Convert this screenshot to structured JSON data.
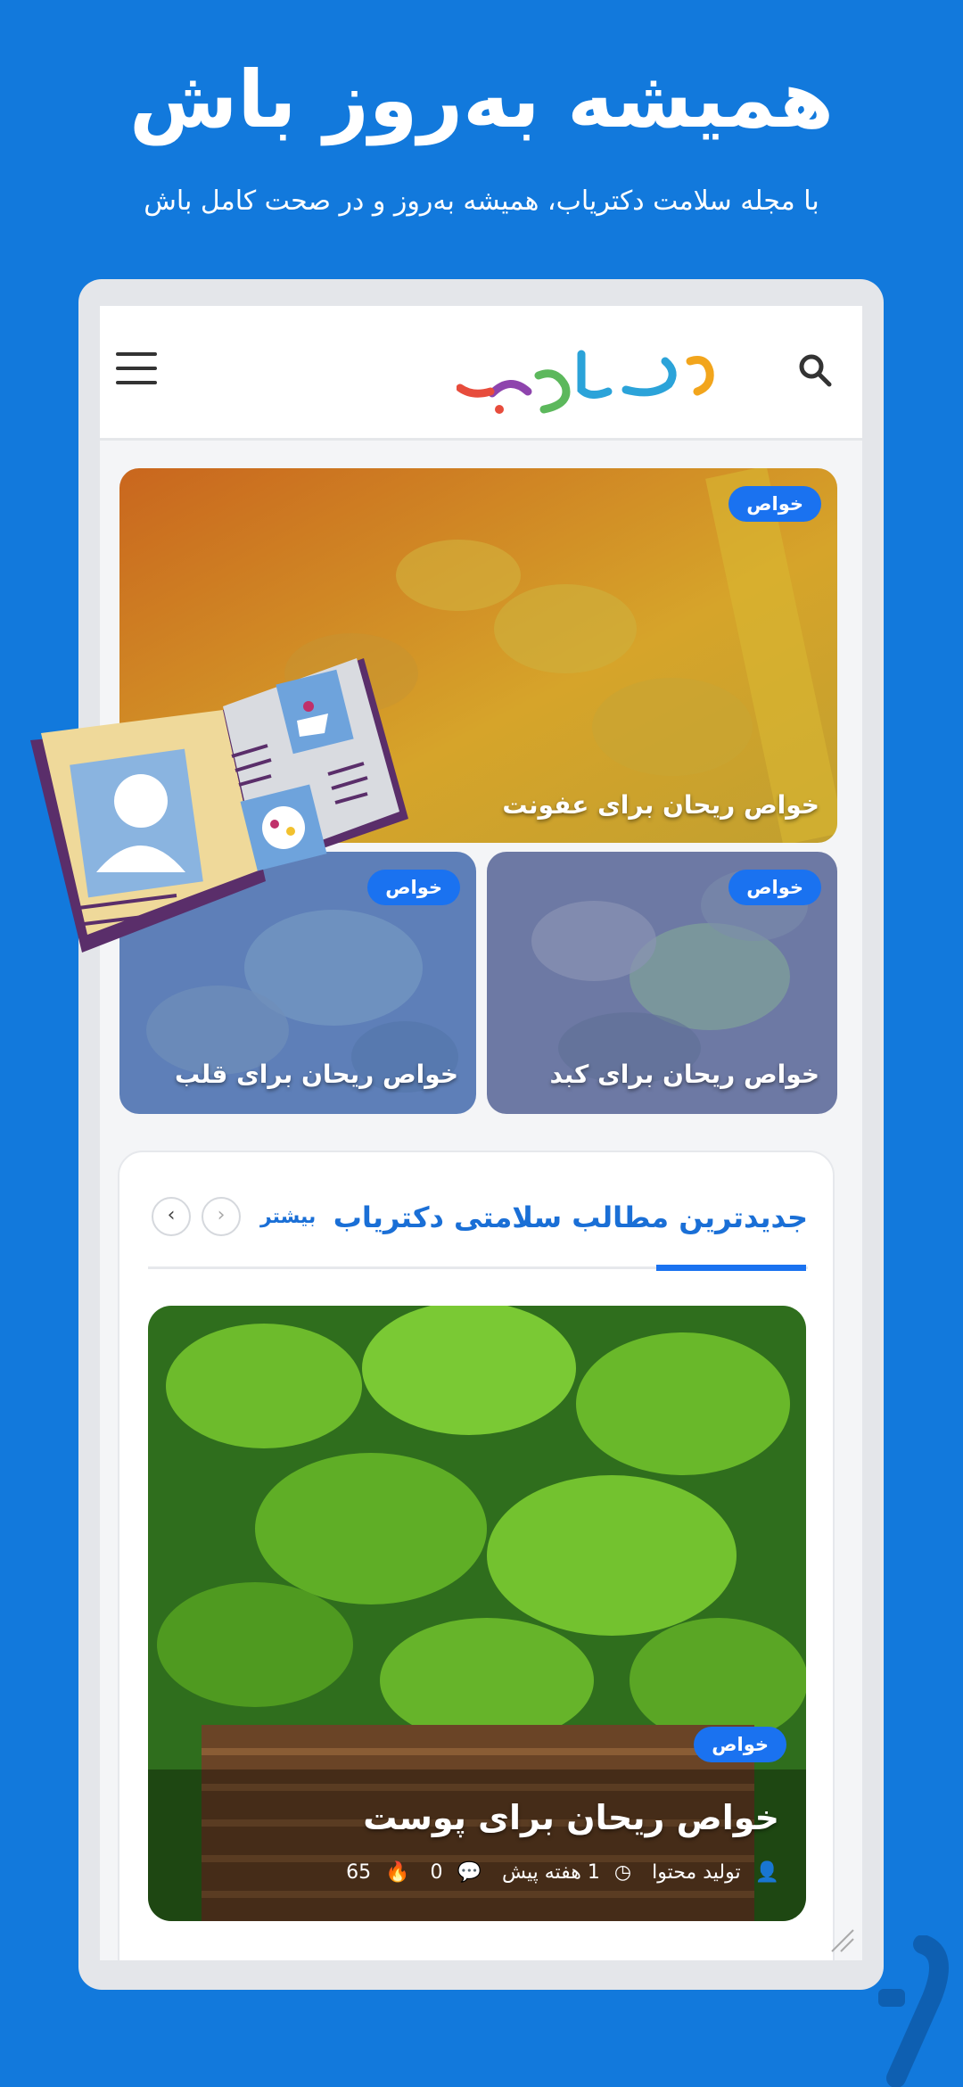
{
  "promo": {
    "headline": "همیشه به‌روز باش",
    "subline": "با مجله سلامت دکتریاب، همیشه به‌روز و در صحت کامل باش"
  },
  "header": {
    "logo_text": "دکتریاب",
    "menu_icon": "hamburger-icon",
    "search_icon": "search-icon"
  },
  "featured": [
    {
      "badge": "خواص",
      "title": "خواص ریحان برای عفونت"
    },
    {
      "badge": "خواص",
      "title": "خواص ریحان برای کبد"
    },
    {
      "badge": "خواص",
      "title": "خواص ریحان برای قلب"
    }
  ],
  "latest": {
    "title": "جدیدترین مطالب سلامتی دکتریاب",
    "more": "بیشتر",
    "prev_icon": "chevron-right-icon",
    "next_icon": "chevron-left-icon",
    "article": {
      "badge": "خواص",
      "title": "خواص ریحان برای پوست",
      "author": "تولید محتوا",
      "time": "1 هفته پیش",
      "comments": "0",
      "views": "65"
    }
  },
  "colors": {
    "background": "#1279dc",
    "accent": "#1a72f0",
    "title_blue": "#1a6fd6"
  }
}
